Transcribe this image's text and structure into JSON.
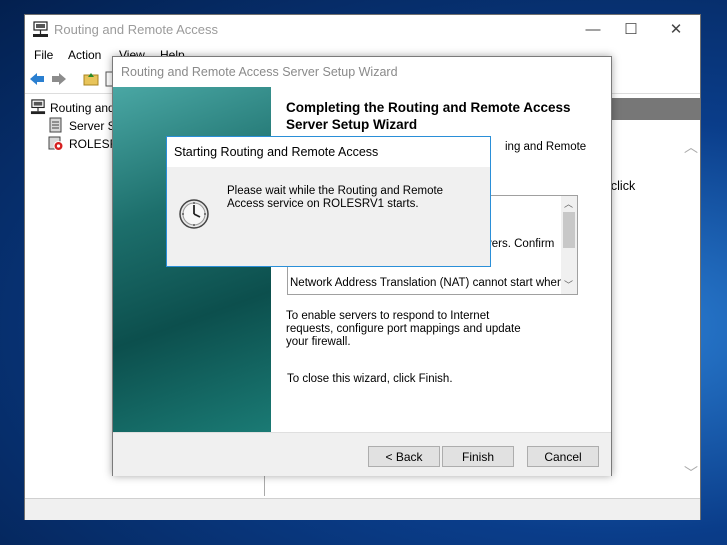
{
  "main_window": {
    "title": "Routing and Remote Access",
    "controls": {
      "minimize": "—",
      "maximize": "☐",
      "close": "✕"
    },
    "menu": [
      "File",
      "Action",
      "View",
      "Help"
    ]
  },
  "tree": {
    "items": [
      {
        "label": "Routing and"
      },
      {
        "label": "Server St"
      },
      {
        "label": "ROLESRV1"
      }
    ]
  },
  "right_pane": {
    "partial_text": "u, click"
  },
  "wizard": {
    "title": "Routing and Remote Access Server Setup Wizard",
    "heading": "Completing the Routing and Remote Access Server Setup Wizard",
    "partial_intro": "ing and Remote",
    "summary_lines": [
      "vers. Confirm",
      "Network Address Translation (NAT) cannot start when"
    ],
    "paragraph1": "To enable servers to respond to Internet requests, configure port mappings and update your firewall.",
    "paragraph2": "To close this wizard, click Finish.",
    "buttons": {
      "back": "< Back",
      "finish": "Finish",
      "cancel": "Cancel"
    }
  },
  "progress_dialog": {
    "title": "Starting Routing and Remote Access",
    "message": "Please wait while the Routing and Remote Access service on ROLESRV1 starts."
  }
}
